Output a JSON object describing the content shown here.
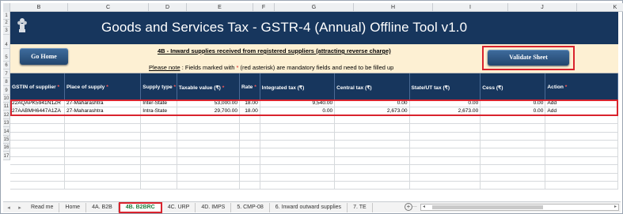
{
  "columns": [
    "B",
    "C",
    "D",
    "E",
    "F",
    "G",
    "H",
    "I",
    "J",
    "K"
  ],
  "row_numbers": [
    "1",
    "2",
    "3",
    "4",
    "5",
    "6",
    "7",
    "8",
    "9",
    "10",
    "11",
    "12",
    "13",
    "14",
    "15",
    "16",
    "17"
  ],
  "banner": {
    "title": "Goods and Services Tax - GSTR-4 (Annual) Offline Tool  v1.0",
    "logo": "emblem-icon"
  },
  "info": {
    "home_button": "Go Home",
    "validate_button": "Validate Sheet",
    "heading": "4B - Inward supplies received from registered suppliers (attracting reverse charge)",
    "note_label": "Please note",
    "note_text_1": " :  Fields marked with ",
    "note_star": "*",
    "note_text_2": " (red asterisk) are mandatory fields and need to be filled up"
  },
  "table": {
    "headers": [
      {
        "label": "GSTIN of supplier",
        "required": true
      },
      {
        "label": "Place of supply",
        "required": true
      },
      {
        "label": "Supply type",
        "required": true
      },
      {
        "label": "Taxable value (₹)",
        "required": true
      },
      {
        "label": "Rate",
        "required": true
      },
      {
        "label": "Integrated tax (₹)",
        "required": false
      },
      {
        "label": "Central tax (₹)",
        "required": false
      },
      {
        "label": "State/UT tax (₹)",
        "required": false
      },
      {
        "label": "Cess (₹)",
        "required": false
      },
      {
        "label": "Action",
        "required": true
      }
    ],
    "rows": [
      [
        "22AQAPK5941N1ZR",
        "27-Maharashtra",
        "Inter-State",
        "53,000.00",
        "18.00",
        "9,540.00",
        "0.00",
        "0.00",
        "0.00",
        "Add"
      ],
      [
        "27AABMH6447A1ZA",
        "27-Maharashtra",
        "Intra-State",
        "29,700.00",
        "18.00",
        "0.00",
        "2,673.00",
        "2,673.00",
        "0.00",
        "Add"
      ]
    ],
    "empty_row_count": 9
  },
  "tabs": {
    "items": [
      "Read me",
      "Home",
      "4A. B2B",
      "4B. B2BRC",
      "4C. URP",
      "4D. IMPS",
      "5. CMP-08",
      "6. Inward outward supplies",
      "7. TE"
    ],
    "active": "4B. B2BRC",
    "ellipsis": "...",
    "add_symbol": "+",
    "prev_arrow": "◂",
    "next_arrow": "▸"
  },
  "colors": {
    "banner": "#17365d",
    "info_background": "#fdf0d3",
    "highlight": "#d9232d",
    "active_tab_text": "#1d7a3a"
  }
}
